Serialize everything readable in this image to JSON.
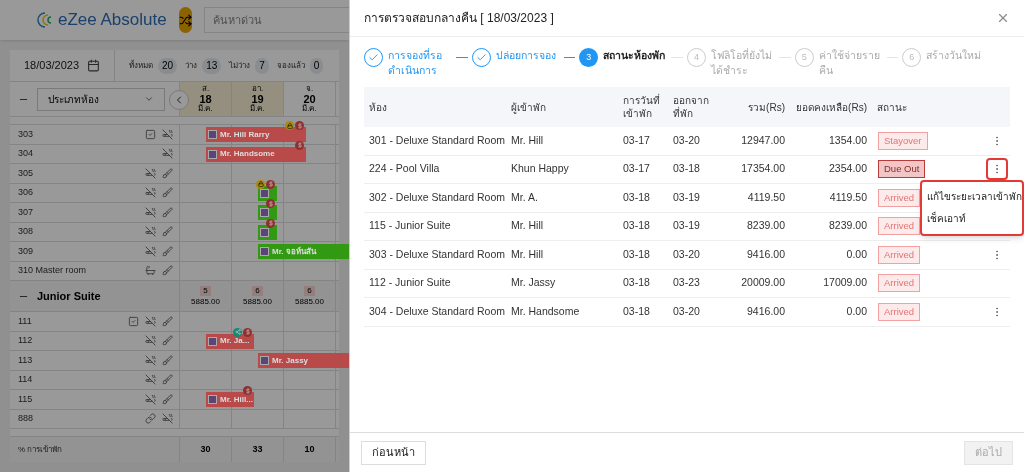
{
  "app": {
    "title": "eZee Absolute",
    "search": {
      "placeholder": "ค้นหาด่วน"
    }
  },
  "toolbar": {
    "date": "18/03/2023",
    "counts": [
      {
        "label": "ทั้งหมด",
        "value": "20"
      },
      {
        "label": "ว่าง",
        "value": "13"
      },
      {
        "label": "ไม่ว่าง",
        "value": "7"
      },
      {
        "label": "จองแล้ว",
        "value": "0"
      }
    ]
  },
  "grid": {
    "filter": "ประเภทห้อง",
    "days": [
      {
        "weekday": "ส.",
        "day": "18",
        "month": "มี.ค.",
        "highlighted": true
      },
      {
        "weekday": "อา.",
        "day": "19",
        "month": "มี.ค.",
        "highlighted": true
      },
      {
        "weekday": "จ.",
        "day": "20",
        "month": "มี.ค.",
        "highlighted": false
      }
    ],
    "rows": [
      {
        "kind": "room",
        "name": "303",
        "icons": [
          {
            "kind": "checklist"
          },
          {
            "kind": "no-smoking"
          }
        ],
        "bookings": [
          {
            "guest": "Mr. Hill Rarry",
            "color": "#b84a4a",
            "badges": [
              {
                "kind": "lock"
              },
              {
                "kind": "dollar"
              }
            ]
          }
        ]
      },
      {
        "kind": "room",
        "name": "304",
        "icons": [
          {
            "kind": "no-smoking"
          }
        ],
        "bookings": [
          {
            "guest": "Mr. Handsome",
            "color": "#b84a4a",
            "badges": [
              {
                "kind": "dollar"
              }
            ]
          }
        ]
      },
      {
        "kind": "room",
        "name": "305",
        "icons": [
          {
            "kind": "no-smoking"
          },
          {
            "kind": "cleaning"
          }
        ]
      },
      {
        "kind": "room",
        "name": "306",
        "icons": [
          {
            "kind": "no-smoking"
          },
          {
            "kind": "cleaning"
          }
        ],
        "bookings": [
          {
            "color": "#329a12",
            "badges": [
              {
                "kind": "lock"
              },
              {
                "kind": "dollar"
              }
            ]
          }
        ]
      },
      {
        "kind": "room",
        "name": "307",
        "icons": [
          {
            "kind": "no-smoking"
          },
          {
            "kind": "cleaning"
          }
        ],
        "bookings": [
          {
            "color": "#329a12",
            "badges": [
              {
                "kind": "dollar"
              }
            ]
          }
        ]
      },
      {
        "kind": "room",
        "name": "308",
        "icons": [
          {
            "kind": "no-smoking"
          },
          {
            "kind": "cleaning"
          }
        ],
        "bookings": [
          {
            "color": "#329a12",
            "badges": [
              {
                "kind": "dollar"
              }
            ]
          }
        ]
      },
      {
        "kind": "room",
        "name": "309",
        "icons": [
          {
            "kind": "no-smoking"
          },
          {
            "kind": "cleaning"
          }
        ],
        "bookings": [
          {
            "guest": "Mr. จอห์นสัน",
            "color": "#329a12"
          }
        ]
      },
      {
        "kind": "room",
        "name": "310 Master room",
        "icons": [
          {
            "kind": "bath"
          },
          {
            "kind": "cleaning"
          }
        ]
      },
      {
        "kind": "group",
        "name": "Junior Suite",
        "cells": [
          {
            "count": "5",
            "price": "5885.00"
          },
          {
            "count": "6",
            "price": "5885.00"
          },
          {
            "count": "6",
            "price": "5885.00"
          }
        ]
      },
      {
        "kind": "room",
        "name": "111",
        "icons": [
          {
            "kind": "checklist"
          },
          {
            "kind": "no-smoking"
          },
          {
            "kind": "cleaning"
          }
        ]
      },
      {
        "kind": "room",
        "name": "112",
        "icons": [
          {
            "kind": "no-smoking"
          },
          {
            "kind": "cleaning"
          }
        ],
        "bookings": [
          {
            "guest": "Mr. Ja...",
            "color": "#b84a4a",
            "badges": [
              {
                "kind": "share"
              },
              {
                "kind": "dollar"
              }
            ]
          }
        ]
      },
      {
        "kind": "room",
        "name": "113",
        "icons": [
          {
            "kind": "no-smoking"
          },
          {
            "kind": "cleaning"
          }
        ],
        "bookings": [
          {
            "guest": "Mr. Jassy",
            "color": "#b84a4a"
          }
        ]
      },
      {
        "kind": "room",
        "name": "114",
        "icons": [
          {
            "kind": "no-smoking"
          },
          {
            "kind": "cleaning"
          }
        ]
      },
      {
        "kind": "room",
        "name": "115",
        "icons": [
          {
            "kind": "no-smoking"
          },
          {
            "kind": "cleaning"
          }
        ],
        "bookings": [
          {
            "guest": "Mr. Hill...",
            "color": "#b84a4a",
            "badges": [
              {
                "kind": "dollar"
              }
            ]
          }
        ]
      },
      {
        "kind": "room",
        "name": "888",
        "icons": [
          {
            "kind": "link"
          },
          {
            "kind": "no-smoking"
          }
        ]
      }
    ],
    "footer": {
      "label": "% การเข้าพัก",
      "values": [
        "30",
        "33",
        "10"
      ]
    }
  },
  "dialog": {
    "title": "การตรวจสอบกลางคืน [ 18/03/2023 ]",
    "steps": [
      {
        "label": "การจองที่รอดำเนินการ",
        "kind": "done"
      },
      {
        "label": "ปล่อยการจอง",
        "kind": "done"
      },
      {
        "number": "3",
        "label": "สถานะห้องพัก",
        "kind": "current"
      },
      {
        "number": "4",
        "label": "โฟลิโอที่ยังไม่ได้ชำระ",
        "kind": "pending"
      },
      {
        "number": "5",
        "label": "ค่าใช้จ่ายรายคืน",
        "kind": "pending"
      },
      {
        "number": "6",
        "label": "สร้างวันใหม่",
        "kind": "pending"
      }
    ],
    "table": {
      "columns": [
        "ห้อง",
        "ผู้เข้าพัก",
        "การวันที่เข้าพัก",
        "ออกจากที่พัก",
        "รวม(Rs)",
        "ยอดคงเหลือ(Rs)",
        "สถานะ"
      ],
      "rows": [
        {
          "room": "301 - Deluxe Standard Room",
          "guest": "Mr. Hill",
          "check_in": "03-17",
          "check_out": "03-20",
          "total": "12947.00",
          "balance": "1354.00",
          "status": {
            "label": "Stayover",
            "kind": "stayover"
          },
          "actions": true,
          "menu_open": false
        },
        {
          "room": "224 - Pool Villa",
          "guest": "Khun Happy",
          "check_in": "03-17",
          "check_out": "03-18",
          "total": "17354.00",
          "balance": "2354.00",
          "status": {
            "label": "Due Out",
            "kind": "due_out"
          },
          "actions": true,
          "menu_open": true
        },
        {
          "room": "302 - Deluxe Standard Room",
          "guest": "Mr. A.",
          "check_in": "03-18",
          "check_out": "03-19",
          "total": "4119.50",
          "balance": "4119.50",
          "status": {
            "label": "Arrived",
            "kind": "arrived"
          }
        },
        {
          "room": "115 - Junior Suite",
          "guest": "Mr. Hill",
          "check_in": "03-18",
          "check_out": "03-19",
          "total": "8239.00",
          "balance": "8239.00",
          "status": {
            "label": "Arrived",
            "kind": "arrived"
          }
        },
        {
          "room": "303 - Deluxe Standard Room",
          "guest": "Mr. Hill",
          "check_in": "03-18",
          "check_out": "03-20",
          "total": "9416.00",
          "balance": "0.00",
          "status": {
            "label": "Arrived",
            "kind": "arrived"
          },
          "actions": true,
          "menu_open": false
        },
        {
          "room": "112 - Junior Suite",
          "guest": "Mr. Jassy",
          "check_in": "03-18",
          "check_out": "03-23",
          "total": "20009.00",
          "balance": "17009.00",
          "status": {
            "label": "Arrived",
            "kind": "arrived"
          },
          "actions": false
        },
        {
          "room": "304 - Deluxe Standard Room",
          "guest": "Mr. Handsome",
          "check_in": "03-18",
          "check_out": "03-20",
          "total": "9416.00",
          "balance": "0.00",
          "status": {
            "label": "Arrived",
            "kind": "arrived"
          },
          "actions": true,
          "menu_open": false
        }
      ]
    },
    "menu": {
      "items": [
        "แก้ไขระยะเวลาเข้าพัก",
        "เช็คเอาท์"
      ]
    },
    "buttons": {
      "back": {
        "label": "ก่อนหน้า",
        "disabled": false
      },
      "next": {
        "label": "ต่อไป",
        "disabled": true
      }
    }
  }
}
